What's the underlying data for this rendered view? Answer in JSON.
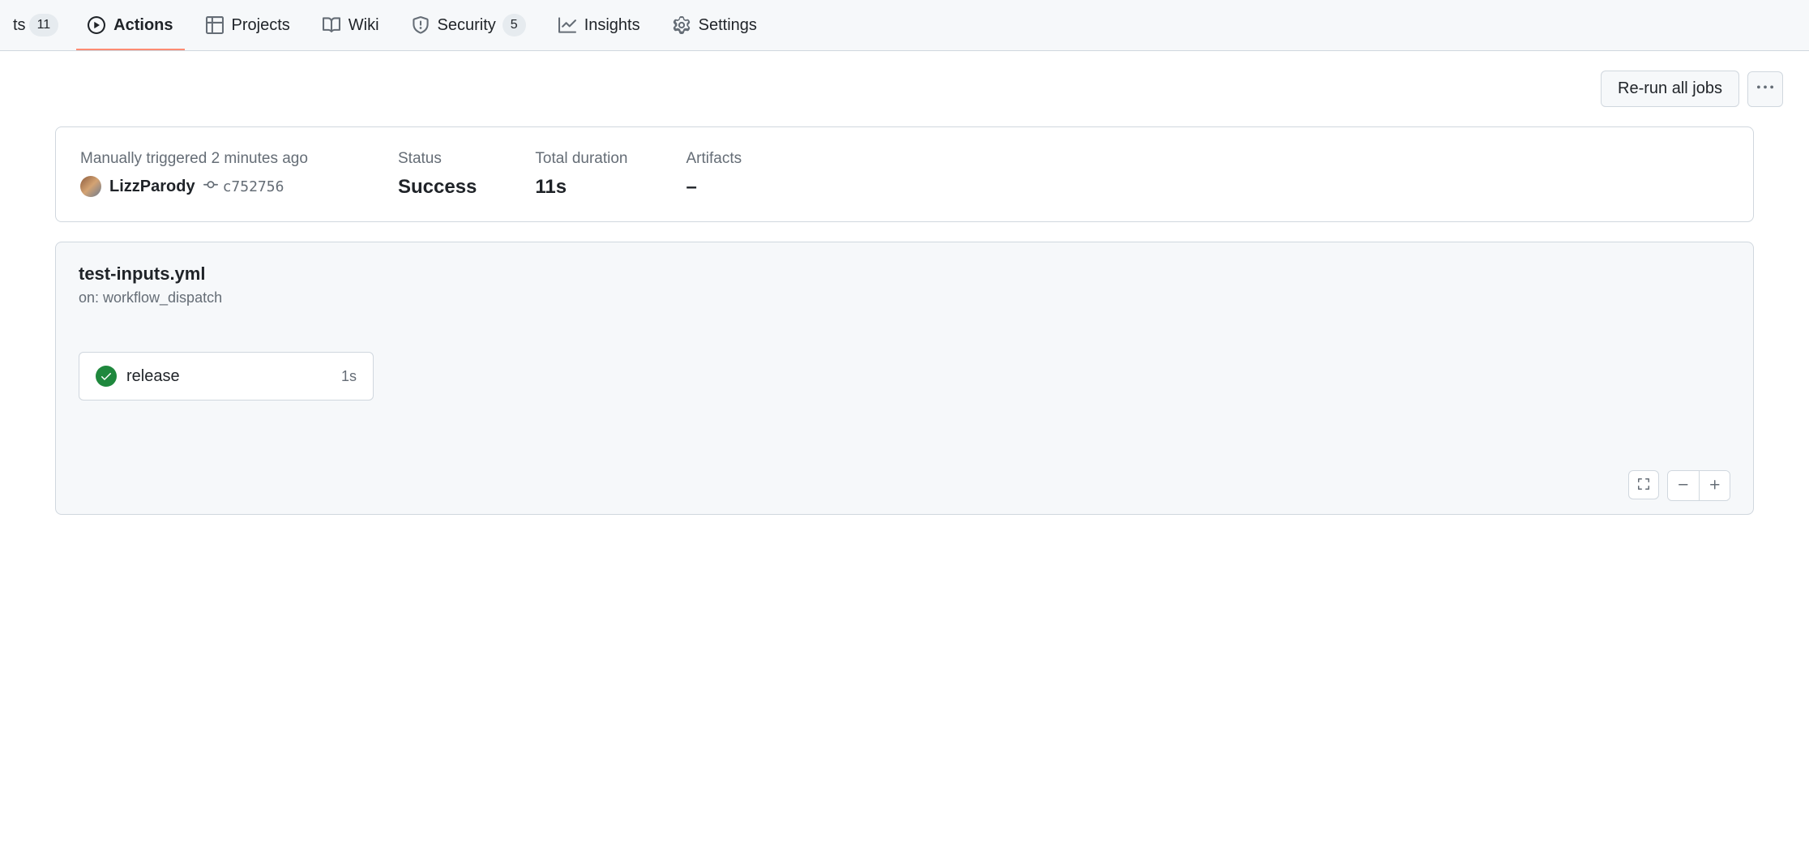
{
  "tabnav": {
    "prev_partial": "ts",
    "prev_count": "11",
    "items": [
      {
        "label": "Actions",
        "icon": "play-icon",
        "active": true
      },
      {
        "label": "Projects",
        "icon": "table-icon"
      },
      {
        "label": "Wiki",
        "icon": "book-icon"
      },
      {
        "label": "Security",
        "icon": "shield-icon",
        "count": "5"
      },
      {
        "label": "Insights",
        "icon": "graph-icon"
      },
      {
        "label": "Settings",
        "icon": "gear-icon"
      }
    ]
  },
  "toolbar": {
    "rerun_label": "Re-run all jobs"
  },
  "summary": {
    "trigger_text": "Manually triggered 2 minutes ago",
    "username": "LizzParody",
    "commit_sha": "c752756",
    "status_label": "Status",
    "status_value": "Success",
    "duration_label": "Total duration",
    "duration_value": "11s",
    "artifacts_label": "Artifacts",
    "artifacts_value": "–"
  },
  "workflow": {
    "title": "test-inputs.yml",
    "trigger": "on: workflow_dispatch",
    "jobs": [
      {
        "name": "release",
        "duration": "1s",
        "status": "success"
      }
    ]
  }
}
